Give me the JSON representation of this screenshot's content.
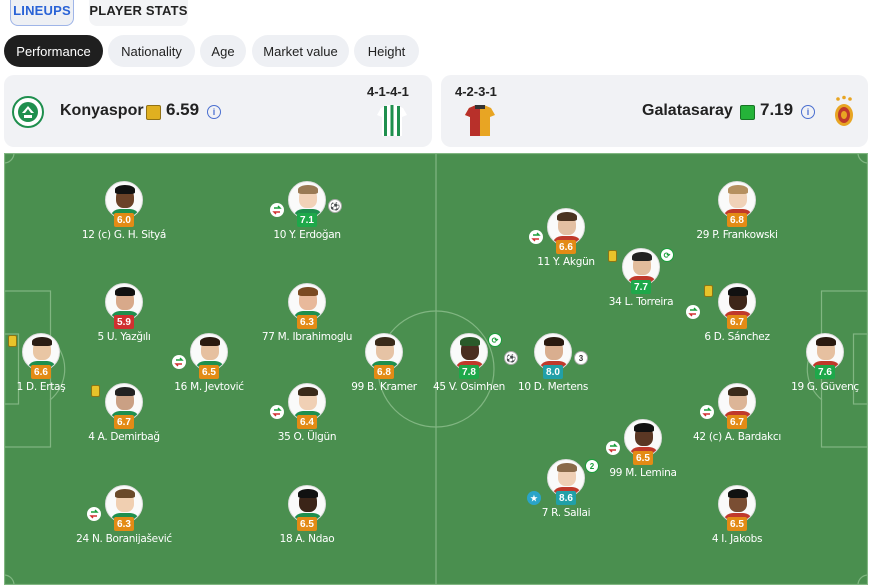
{
  "tabs": [
    {
      "label": "LINEUPS",
      "active": true
    },
    {
      "label": "PLAYER STATS",
      "active": false
    }
  ],
  "filters": [
    {
      "label": "Performance",
      "active": true
    },
    {
      "label": "Nationality",
      "active": false
    },
    {
      "label": "Age",
      "active": false
    },
    {
      "label": "Market value",
      "active": false
    },
    {
      "label": "Height",
      "active": false
    }
  ],
  "home": {
    "name": "Konyaspor",
    "rating": "6.59",
    "rating_color": "#e0b020",
    "formation": "4-1-4-1",
    "kit_colors": [
      "#1f8f4e",
      "#ffffff"
    ]
  },
  "away": {
    "name": "Galatasaray",
    "rating": "7.19",
    "rating_color": "#25b339",
    "formation": "4-2-3-1",
    "kit_colors": [
      "#c0392b",
      "#e8a523"
    ]
  },
  "rating_colors": {
    "orange": "#e38b15",
    "green": "#1ea84a",
    "teal": "#21a0a8",
    "red": "#d03030"
  },
  "players": [
    {
      "name": "1 D. Ertaş",
      "rating": "6.6",
      "color": "orange",
      "events": [
        "card"
      ]
    },
    {
      "name": "12 (c) G. H. Sityá",
      "rating": "6.0",
      "color": "orange",
      "events": []
    },
    {
      "name": "5 U. Yazğılı",
      "rating": "5.9",
      "color": "red",
      "events": []
    },
    {
      "name": "4 A. Demirbağ",
      "rating": "6.7",
      "color": "orange",
      "events": [
        "card"
      ]
    },
    {
      "name": "24 N. Boranijašević",
      "rating": "6.3",
      "color": "orange",
      "events": [
        "sub-out"
      ]
    },
    {
      "name": "16 M. Jevtović",
      "rating": "6.5",
      "color": "orange",
      "events": [
        "sub-out"
      ]
    },
    {
      "name": "10 Y. Erdoğan",
      "rating": "7.1",
      "color": "green",
      "events": [
        "sub-out",
        "goal"
      ]
    },
    {
      "name": "77 M. Ibrahimoglu",
      "rating": "6.3",
      "color": "orange",
      "events": []
    },
    {
      "name": "35 O. Ülgün",
      "rating": "6.4",
      "color": "orange",
      "events": [
        "sub-out"
      ]
    },
    {
      "name": "18 A. Ndao",
      "rating": "6.5",
      "color": "orange",
      "events": []
    },
    {
      "name": "99 B. Kramer",
      "rating": "6.8",
      "color": "orange",
      "events": []
    },
    {
      "name": "45 V. Osimhen",
      "rating": "7.8",
      "color": "green",
      "events": [
        "assist",
        "goal"
      ]
    },
    {
      "name": "11 Y. Akgün",
      "rating": "6.6",
      "color": "orange",
      "events": [
        "sub-out"
      ]
    },
    {
      "name": "10 D. Mertens",
      "rating": "8.0",
      "color": "teal",
      "events": [
        "goal3"
      ]
    },
    {
      "name": "7 R. Sallai",
      "rating": "8.6",
      "color": "teal",
      "events": [
        "assist2",
        "star"
      ]
    },
    {
      "name": "34 L. Torreira",
      "rating": "7.7",
      "color": "green",
      "events": [
        "card",
        "assist"
      ]
    },
    {
      "name": "99 M. Lemina",
      "rating": "6.5",
      "color": "orange",
      "events": [
        "sub-out"
      ]
    },
    {
      "name": "29 P. Frankowski",
      "rating": "6.8",
      "color": "orange",
      "events": []
    },
    {
      "name": "6 D. Sánchez",
      "rating": "6.7",
      "color": "orange",
      "events": [
        "card",
        "sub-out"
      ]
    },
    {
      "name": "42 (c) A. Bardakcı",
      "rating": "6.7",
      "color": "orange",
      "events": [
        "sub-out"
      ]
    },
    {
      "name": "4 I. Jakobs",
      "rating": "6.5",
      "color": "orange",
      "events": []
    },
    {
      "name": "19 G. Güvenç",
      "rating": "7.6",
      "color": "green",
      "events": []
    }
  ]
}
